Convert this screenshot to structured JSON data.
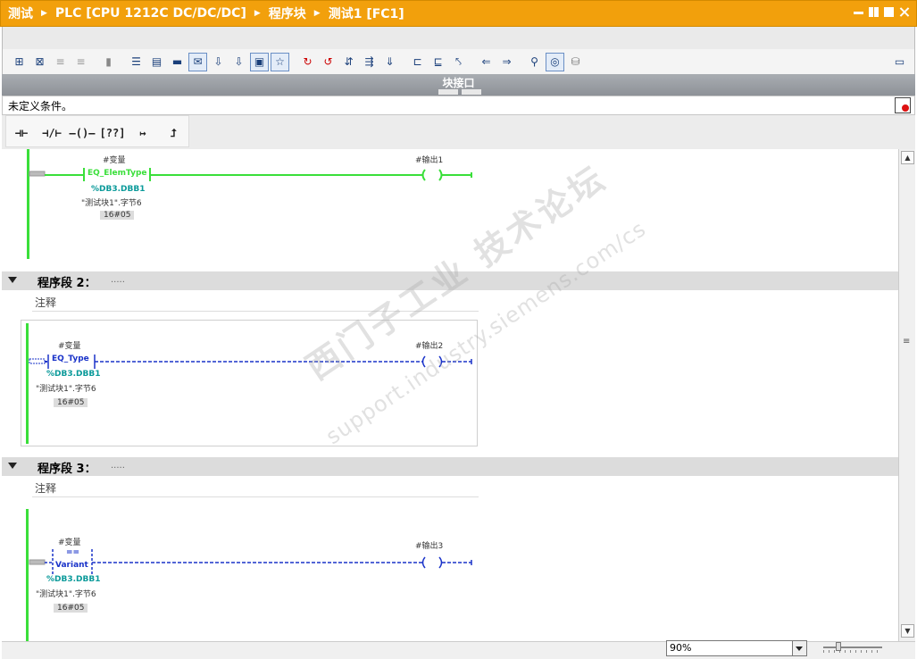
{
  "breadcrumb": [
    "测试",
    "PLC [CPU 1212C DC/DC/DC]",
    "程序块",
    "测试1 [FC1]"
  ],
  "interface_bar": "块接口",
  "condition_text": "未定义条件。",
  "ladder_buttons": [
    "⊣⊢",
    "⊣/⊢",
    "–()–",
    "[??]",
    "↦",
    "⮥"
  ],
  "networks": [
    {
      "contact_label": "#变量",
      "instruction": "EQ_ElemType",
      "operand": "%DB3.DBB1",
      "symbol": "\"测试块1\".字节6",
      "value": "16#05",
      "coil_label": "#输出1"
    },
    {
      "header": "程序段 2：",
      "dots": ".....",
      "comment": "注释",
      "contact_label": "#变量",
      "instruction": "EQ_Type",
      "operand": "%DB3.DBB1",
      "symbol": "\"测试块1\".字节6",
      "value": "16#05",
      "coil_label": "#输出2"
    },
    {
      "header": "程序段 3：",
      "dots": ".....",
      "comment": "注释",
      "contact_label": "#变量",
      "instruction_eq": "==",
      "instruction": "Variant",
      "operand": "%DB3.DBB1",
      "symbol": "\"测试块1\".字节6",
      "value": "16#05",
      "coil_label": "#输出3"
    }
  ],
  "zoom": "90%",
  "watermark": "西门子工业 技术论坛",
  "watermark_url": "support.industry.siemens.com/cs",
  "colors": {
    "title": "#f2a00c",
    "energized": "#3adf3a",
    "dashed": "#1a33c9"
  }
}
